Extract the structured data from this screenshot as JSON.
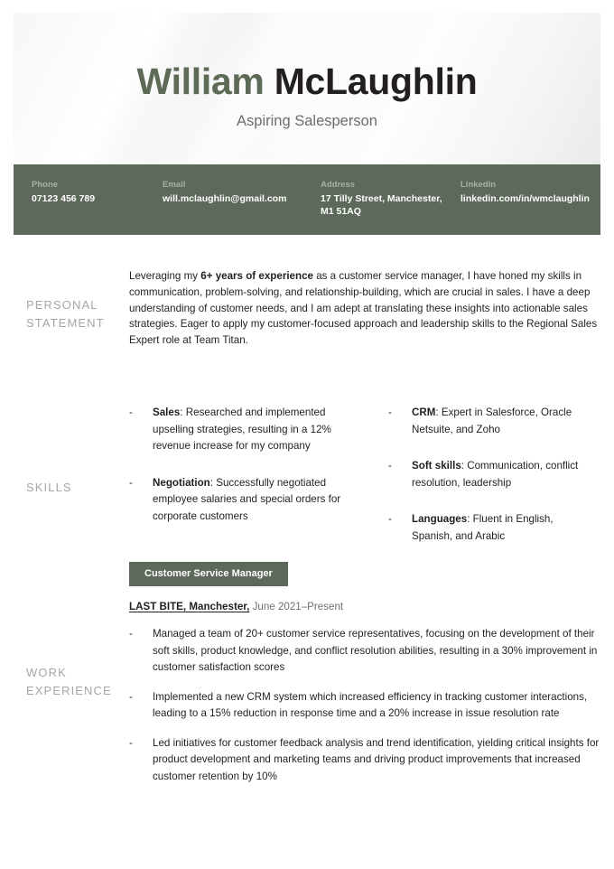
{
  "header": {
    "name_first": "William",
    "name_last": "McLaughlin",
    "job_title": "Aspiring Salesperson",
    "accent_green": "#5d6a5b",
    "name_first_color": "#5d6a55"
  },
  "contact": {
    "items": [
      {
        "label": "Phone",
        "value": "07123 456 789"
      },
      {
        "label": "Email",
        "value": "will.mclaughlin@gmail.com"
      },
      {
        "label": "Address",
        "value": "17 Tilly Street, Manchester, M1 51AQ"
      },
      {
        "label": "LinkedIn",
        "value": "linkedin.com/in/wmclaughlin"
      }
    ]
  },
  "statement": {
    "label": "PERSONAL STATEMENT",
    "text_pre": "Leveraging my ",
    "text_bold": "6+ years of experience",
    "text_post": " as a customer service manager, I have honed my skills in communication, problem-solving, and relationship-building, which are crucial in sales. I have a deep understanding of customer needs, and I am adept at translating these insights into actionable sales strategies. Eager to apply my customer-focused approach and leadership skills to the Regional Sales Expert role at Team Titan."
  },
  "skills": {
    "label": "SKILLS",
    "bullet": "-",
    "left": [
      {
        "title": "Sales",
        "body": ": Researched and implemented upselling strategies, resulting in a 12% revenue increase for my company"
      },
      {
        "title": "Negotiation",
        "body": ": Successfully negotiated employee salaries and special orders for corporate customers"
      }
    ],
    "right": [
      {
        "title": "CRM",
        "body": ": Expert in Salesforce, Oracle Netsuite, and Zoho"
      },
      {
        "title": "Soft skills",
        "body": ": Communication, conflict resolution, leadership"
      },
      {
        "title": "Languages",
        "body": ": Fluent in English, Spanish, and Arabic"
      }
    ]
  },
  "work": {
    "label": "WORK EXPERIENCE",
    "bullet": "-",
    "role_badge": "Customer Service Manager",
    "company": "LAST BITE, Manchester,",
    "dates": " June 2021–Present",
    "bullets": [
      "Managed a team of 20+ customer service representatives, focusing on the development of their soft skills, product knowledge, and conflict resolution abilities, resulting in a 30% improvement in customer satisfaction scores",
      "Implemented a new CRM system which increased efficiency in tracking customer interactions, leading to a 15% reduction in response time and a 20% increase in issue resolution rate",
      "Led initiatives for customer feedback analysis and trend identification, yielding critical insights for product development and marketing teams and driving product improvements that increased customer retention by 10%"
    ]
  }
}
